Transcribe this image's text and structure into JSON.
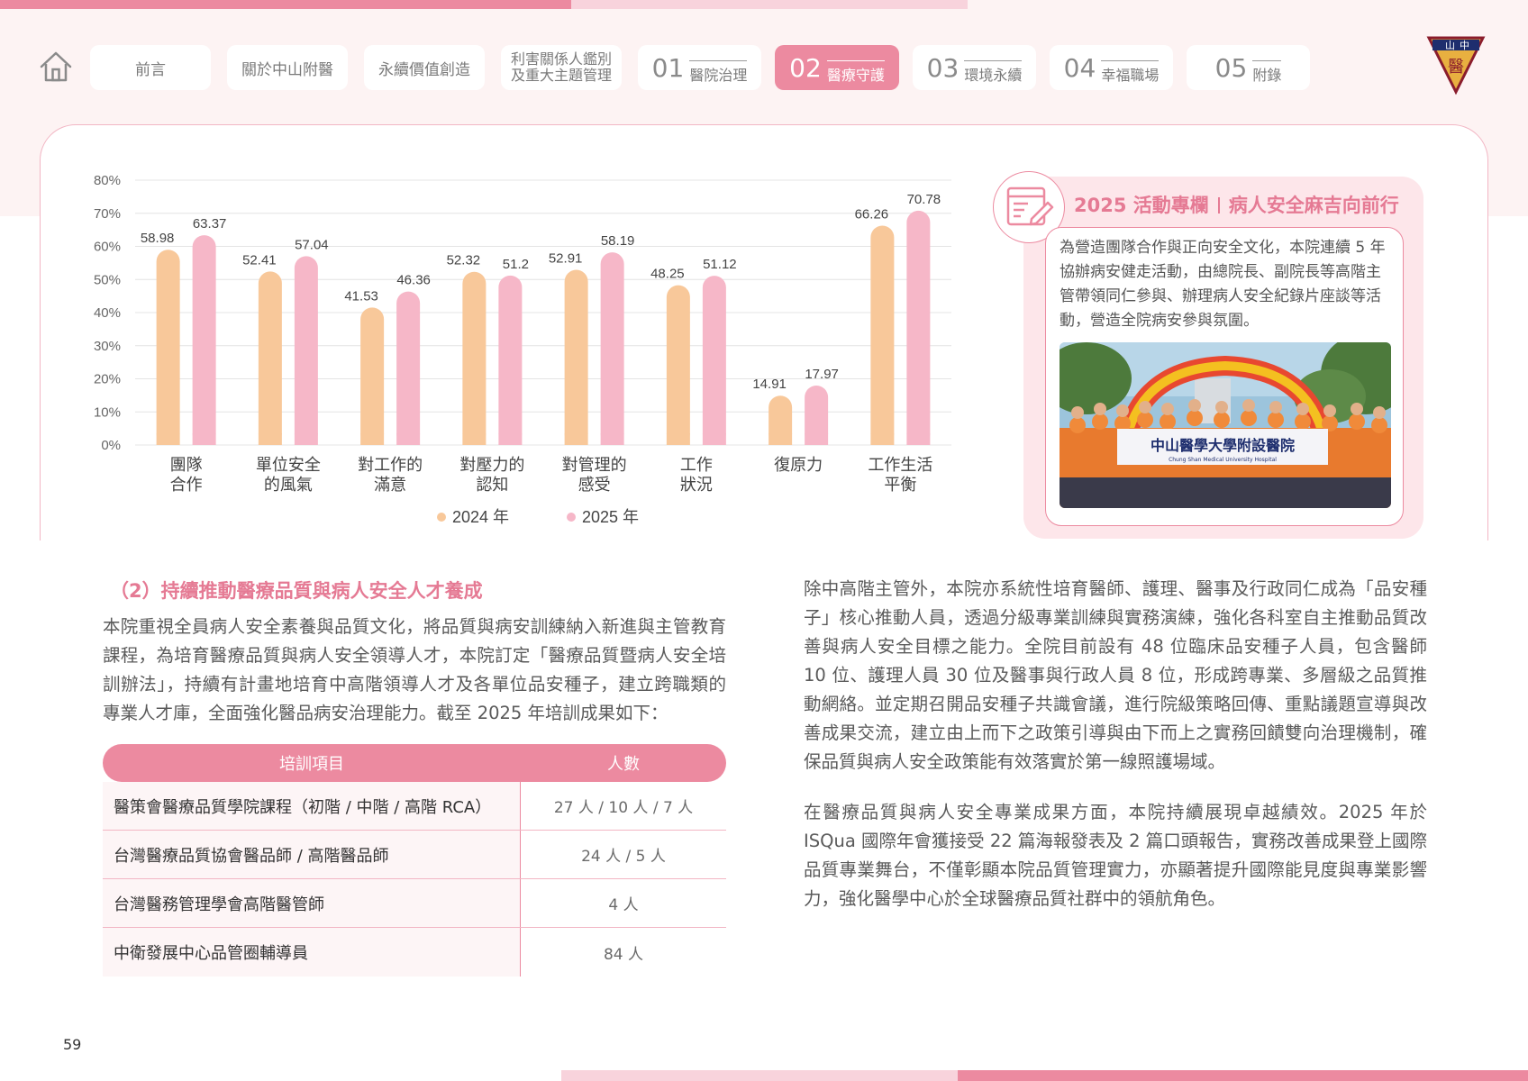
{
  "nav": {
    "tabs": [
      {
        "label": "前言"
      },
      {
        "label": "關於中山附醫"
      },
      {
        "label": "永續價值創造"
      },
      {
        "line1": "利害關係人鑑別",
        "line2": "及重大主題管理"
      },
      {
        "num": "01",
        "label": "醫院治理"
      },
      {
        "num": "02",
        "label": "醫療守護"
      },
      {
        "num": "03",
        "label": "環境永續"
      },
      {
        "num": "04",
        "label": "幸福職場"
      },
      {
        "num": "05",
        "label": "附錄"
      }
    ]
  },
  "logo": {
    "text": "山中",
    "subtext": "醫"
  },
  "colors": {
    "accent": "#ec8aa0",
    "series2024": "#f8c89a",
    "series2025": "#f6b7c8"
  },
  "chart_data": {
    "type": "bar",
    "categories": [
      [
        "團隊",
        "合作"
      ],
      [
        "單位安全",
        "的風氣"
      ],
      [
        "對工作的",
        "滿意"
      ],
      [
        "對壓力的",
        "認知"
      ],
      [
        "對管理的",
        "感受"
      ],
      [
        "工作",
        "狀況"
      ],
      [
        "復原力"
      ],
      [
        "工作生活",
        "平衡"
      ]
    ],
    "series": [
      {
        "name": "2024 年",
        "values": [
          58.98,
          52.41,
          41.53,
          52.32,
          52.91,
          48.25,
          14.91,
          66.26
        ]
      },
      {
        "name": "2025 年",
        "values": [
          63.37,
          57.04,
          46.36,
          51.2,
          58.19,
          51.12,
          17.97,
          70.78
        ]
      }
    ],
    "yticks": [
      "0%",
      "10%",
      "20%",
      "30%",
      "40%",
      "50%",
      "60%",
      "70%",
      "80%"
    ],
    "ylim": [
      0,
      80
    ],
    "grid": true,
    "legend": "bottom-center"
  },
  "sidebar": {
    "title_left": "2025 活動專欄",
    "title_right": "病人安全麻吉向前行",
    "text": "為營造團隊合作與正向安全文化，本院連續 5 年協辦病安健走活動，由總院長、副院長等高階主管帶領同仁參與、辦理病人安全紀錄片座談等活動，營造全院病安參與氛圍。",
    "photo_banner": "中山醫學大學附設醫院",
    "photo_banner_sub": "Chung Shan Medical University Hospital"
  },
  "section": {
    "title": "（2）持續推動醫療品質與病人安全人才養成",
    "para1": "本院重視全員病人安全素養與品質文化，將品質與病安訓練納入新進與主管教育課程，為培育醫療品質與病人安全領導人才，本院訂定「醫療品質暨病人安全培訓辦法」，持續有計畫地培育中高階領導人才及各單位品安種子，建立跨職類的專業人才庫，全面強化醫品病安治理能力。截至 2025 年培訓成果如下：",
    "para2": "除中高階主管外，本院亦系統性培育醫師、護理、醫事及行政同仁成為「品安種子」核心推動人員，透過分級專業訓練與實務演練，強化各科室自主推動品質改善與病人安全目標之能力。全院目前設有 48 位臨床品安種子人員，包含醫師 10 位、護理人員 30 位及醫事與行政人員 8 位，形成跨專業、多層級之品質推動網絡。並定期召開品安種子共識會議，進行院級策略回傳、重點議題宣導與改善成果交流，建立由上而下之政策引導與由下而上之實務回饋雙向治理機制，確保品質與病人安全政策能有效落實於第一線照護場域。",
    "para3": "在醫療品質與病人安全專業成果方面，本院持續展現卓越績效。2025 年於 ISQua 國際年會獲接受 22 篇海報發表及 2 篇口頭報告，實務改善成果登上國際品質專業舞台，不僅彰顯本院品質管理實力，亦顯著提升國際能見度與專業影響力，強化醫學中心於全球醫療品質社群中的領航角色。"
  },
  "table": {
    "headers": [
      "培訓項目",
      "人數"
    ],
    "rows": [
      [
        "醫策會醫療品質學院課程（初階 / 中階 / 高階 RCA）",
        "27 人 / 10 人 / 7 人"
      ],
      [
        "台灣醫療品質協會醫品師 / 高階醫品師",
        "24 人 / 5 人"
      ],
      [
        "台灣醫務管理學會高階醫管師",
        "4 人"
      ],
      [
        "中衛發展中心品管圈輔導員",
        "84 人"
      ]
    ]
  },
  "page_number": "59"
}
